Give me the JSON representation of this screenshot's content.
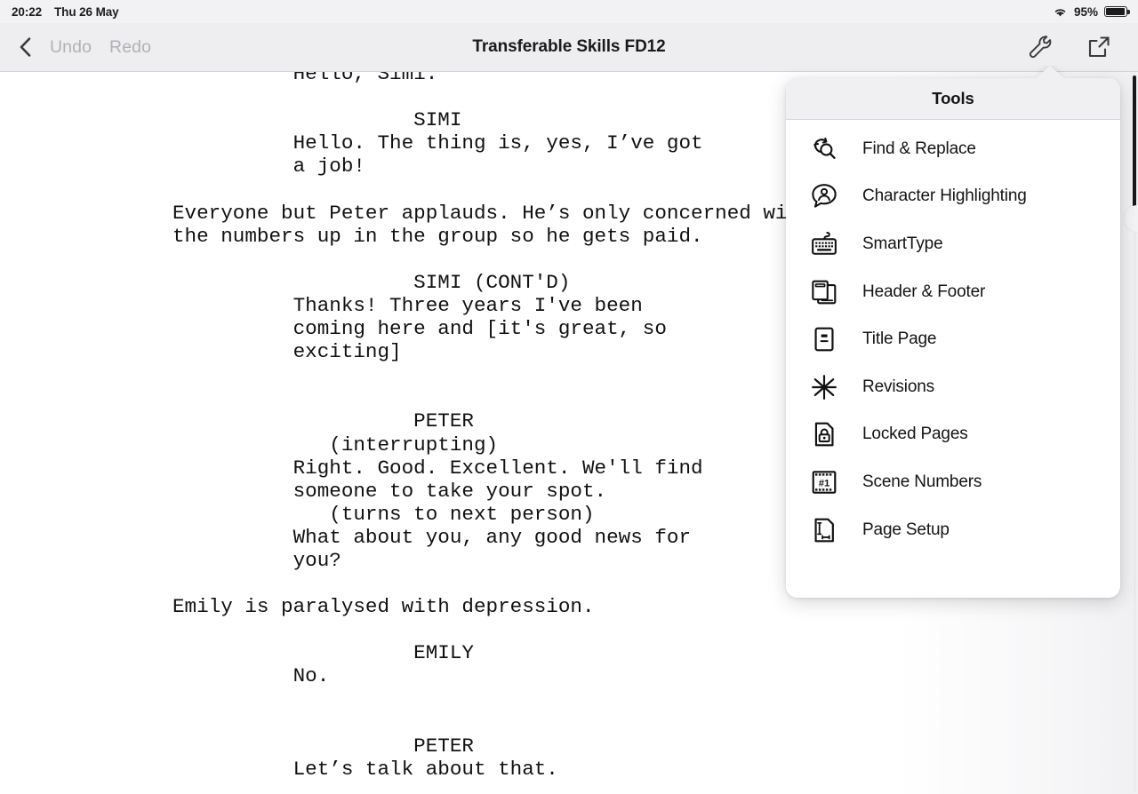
{
  "status_bar": {
    "time": "20:22",
    "date": "Thu 26 May",
    "wifi_icon": "wifi-icon",
    "battery_percent": "95%",
    "battery_icon": "battery-icon"
  },
  "navbar": {
    "back_icon": "chevron-left-icon",
    "undo_label": "Undo",
    "redo_label": "Redo",
    "title": "Transferable Skills FD12",
    "tools_icon": "wrench-icon",
    "share_icon": "share-export-icon"
  },
  "document": {
    "lines": [
      {
        "text": "          Hello, Simi.",
        "clipped": true
      },
      {
        "text": ""
      },
      {
        "text": "                    SIMI"
      },
      {
        "text": "          Hello. The thing is, yes, I’ve got"
      },
      {
        "text": "          a job!"
      },
      {
        "text": ""
      },
      {
        "text": "Everyone but Peter applauds. He’s only concerned with getting"
      },
      {
        "text": "the numbers up in the group so he gets paid."
      },
      {
        "text": ""
      },
      {
        "text": "                    SIMI (CONT'D)"
      },
      {
        "text": "          Thanks! Three years I've been"
      },
      {
        "text": "          coming here and [it's great, so"
      },
      {
        "text": "          exciting]"
      },
      {
        "text": ""
      },
      {
        "text": ""
      },
      {
        "text": "                    PETER"
      },
      {
        "text": "             (interrupting)"
      },
      {
        "text": "          Right. Good. Excellent. We'll find"
      },
      {
        "text": "          someone to take your spot."
      },
      {
        "text": "             (turns to next person)"
      },
      {
        "text": "          What about you, any good news for"
      },
      {
        "text": "          you?"
      },
      {
        "text": ""
      },
      {
        "text": "Emily is paralysed with depression."
      },
      {
        "text": ""
      },
      {
        "text": "                    EMILY"
      },
      {
        "text": "          No."
      },
      {
        "text": ""
      },
      {
        "text": ""
      },
      {
        "text": "                    PETER"
      },
      {
        "text": "          Let’s talk about that."
      }
    ]
  },
  "tools_popover": {
    "title": "Tools",
    "items": [
      {
        "label": "Find & Replace",
        "icon": "find-replace-icon"
      },
      {
        "label": "Character Highlighting",
        "icon": "character-highlighting-icon"
      },
      {
        "label": "SmartType",
        "icon": "keyboard-icon"
      },
      {
        "label": "Header & Footer",
        "icon": "header-footer-icon"
      },
      {
        "label": "Title Page",
        "icon": "title-page-icon"
      },
      {
        "label": "Revisions",
        "icon": "asterisk-icon"
      },
      {
        "label": "Locked Pages",
        "icon": "lock-page-icon"
      },
      {
        "label": "Scene Numbers",
        "icon": "film-strip-number-icon"
      },
      {
        "label": "Page Setup",
        "icon": "page-setup-icon"
      }
    ]
  },
  "colors": {
    "status_bar_bg": "#f2f2f5",
    "navbar_bg": "#eeeef1",
    "popover_header_bg": "#f0f0f3",
    "popover_bg": "#ffffff",
    "text_primary": "#141416",
    "text_disabled": "#b0b0b6",
    "page_bg": "#ffffff"
  }
}
